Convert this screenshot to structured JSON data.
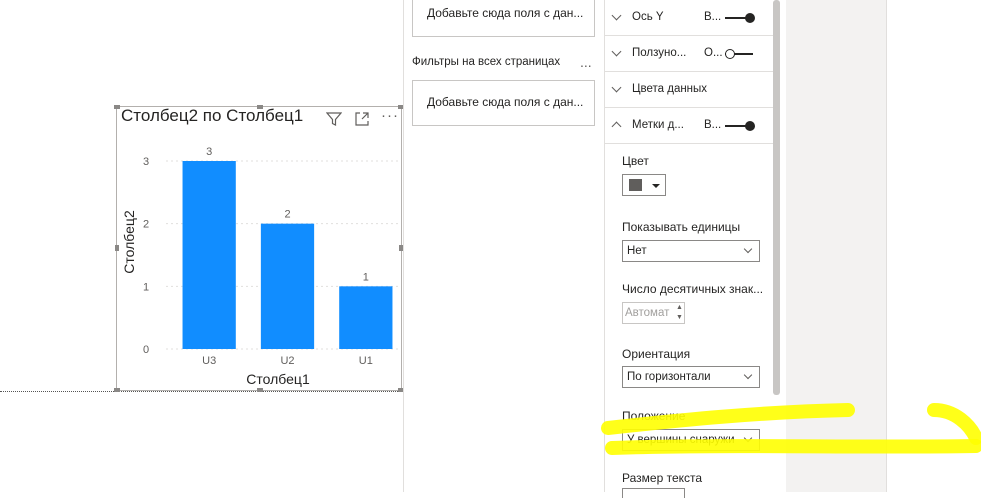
{
  "visual": {
    "title": "Столбец2 по Столбец1",
    "icons": [
      "filter-icon",
      "focus-mode-icon",
      "more-options-icon"
    ]
  },
  "chart_data": {
    "type": "bar",
    "categories": [
      "U3",
      "U2",
      "U1"
    ],
    "values": [
      3,
      2,
      1
    ],
    "data_labels": [
      "3",
      "2",
      "1"
    ],
    "xlabel": "Столбец1",
    "ylabel": "Столбец2",
    "ylim": [
      0,
      3
    ],
    "yticks": [
      "0",
      "1",
      "2",
      "3"
    ],
    "bar_color": "#118DFF",
    "grid": true
  },
  "filters": {
    "well_top": "Добавьте сюда поля с дан...",
    "all_pages_label": "Фильтры на всех страницах",
    "more": "...",
    "well_all_pages": "Добавьте сюда поля с дан..."
  },
  "format": {
    "sections": [
      {
        "title": "Ось Y",
        "value": "В...",
        "toggle": "on",
        "expanded": false
      },
      {
        "title": "Ползуно...",
        "value": "О...",
        "toggle": "off",
        "expanded": false
      },
      {
        "title": "Цвета данных",
        "value": "",
        "toggle": "none",
        "expanded": false
      },
      {
        "title": "Метки д...",
        "value": "В...",
        "toggle": "on",
        "expanded": true
      }
    ],
    "color_label": "Цвет",
    "color_value": "#605E5C",
    "units_label": "Показывать единицы",
    "units_value": "Нет",
    "decimals_label": "Число десятичных знак...",
    "decimals_value": "Автомат",
    "orientation_label": "Ориентация",
    "orientation_value": "По горизонтали",
    "position_label": "Положение",
    "position_value": "У вершины снаружи",
    "text_size_label": "Размер текста"
  },
  "annotation": {
    "color": "#FFFF00"
  }
}
